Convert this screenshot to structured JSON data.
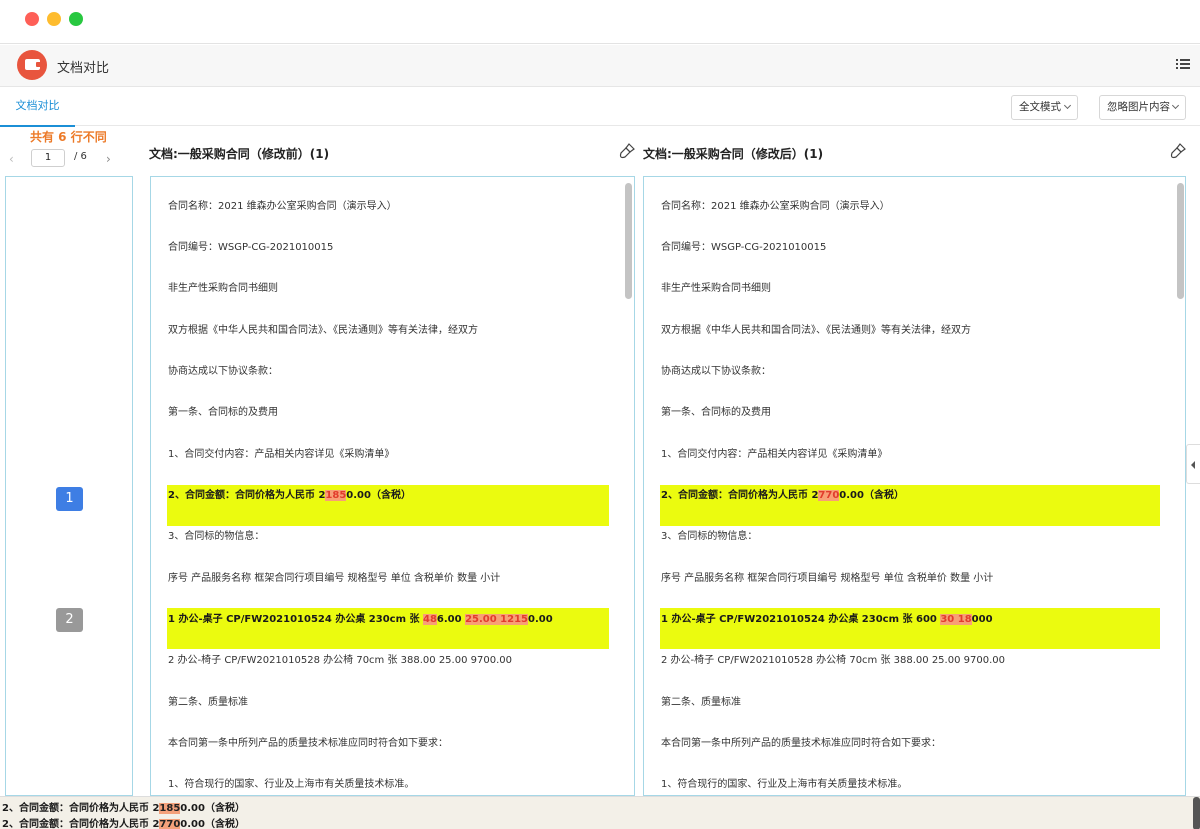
{
  "app": {
    "title": "文档对比",
    "tab_label": "文档对比",
    "mode_select": "全文模式",
    "ignore_select": "忽略图片内容"
  },
  "diff_summary": {
    "count_text": "共有 6 行不同",
    "page_current": "1",
    "page_total": "/ 6",
    "prev_symbol": "‹",
    "next_symbol": "›",
    "markers": [
      "1",
      "2"
    ]
  },
  "left_doc": {
    "title": "文档:一般采购合同（修改前）(1)",
    "lines": [
      "合同名称：2021 维森办公室采购合同（演示导入）",
      "合同编号：WSGP-CG-2021010015",
      "非生产性采购合同书细则",
      "双方根据《中华人民共和国合同法》、《民法通则》等有关法律，经双方",
      "协商达成以下协议条款：",
      "第一条、合同标的及费用",
      "1、合同交付内容：产品相关内容详见《采购清单》",
      "3、合同标的物信息：",
      "序号 产品服务名称 框架合同行项目编号 规格型号 单位 含税单价 数量 小计",
      "2 办公-椅子 CP/FW2021010528 办公椅 70cm 张 388.00 25.00 9700.00",
      "第二条、质量标准",
      "本合同第一条中所列产品的质量技术标准应同时符合如下要求：",
      "1、符合现行的国家、行业及上海市有关质量技术标准。"
    ],
    "diff1": {
      "pre": "2、合同金额：合同价格为人民币 2",
      "mark": "185",
      "post": "0.00（含税）"
    },
    "diff2": {
      "pre": "1 办公-桌子 CP/FW2021010524 办公桌 230cm 张 ",
      "mark1": "48",
      "mid": "6.00 ",
      "mark2": "25.00 1215",
      "post": "0.00"
    }
  },
  "right_doc": {
    "title": "文档:一般采购合同（修改后）(1)",
    "lines": [
      "合同名称：2021 维森办公室采购合同（演示导入）",
      "合同编号：WSGP-CG-2021010015",
      "非生产性采购合同书细则",
      "双方根据《中华人民共和国合同法》、《民法通则》等有关法律，经双方",
      "协商达成以下协议条款：",
      "第一条、合同标的及费用",
      "1、合同交付内容：产品相关内容详见《采购清单》",
      "3、合同标的物信息：",
      "序号 产品服务名称 框架合同行项目编号 规格型号 单位 含税单价 数量 小计",
      "2 办公-椅子 CP/FW2021010528 办公椅 70cm 张 388.00 25.00 9700.00",
      "第二条、质量标准",
      "本合同第一条中所列产品的质量技术标准应同时符合如下要求：",
      "1、符合现行的国家、行业及上海市有关质量技术标准。"
    ],
    "diff1": {
      "pre": "2、合同金额：合同价格为人民币 2",
      "mark": "770",
      "post": "0.00（含税）"
    },
    "diff2": {
      "pre": "1 办公-桌子 CP/FW2021010524 办公桌 230cm 张 600 ",
      "mark1": "30 18",
      "mid": "",
      "mark2": "",
      "post": "000"
    }
  },
  "bottom": {
    "line1": {
      "pre": "2、合同金额：合同价格为人民币 2",
      "mark": "185",
      "post": "0.00（含税）"
    },
    "line2": {
      "pre": "2、合同金额：合同价格为人民币 2",
      "mark": "770",
      "post": "0.00（含税）"
    }
  },
  "colors": {
    "highlight": "#ebfb0f",
    "diff_text": "#e23c2c",
    "accent": "#1b8fd6",
    "count_orange": "#ec7a28"
  }
}
